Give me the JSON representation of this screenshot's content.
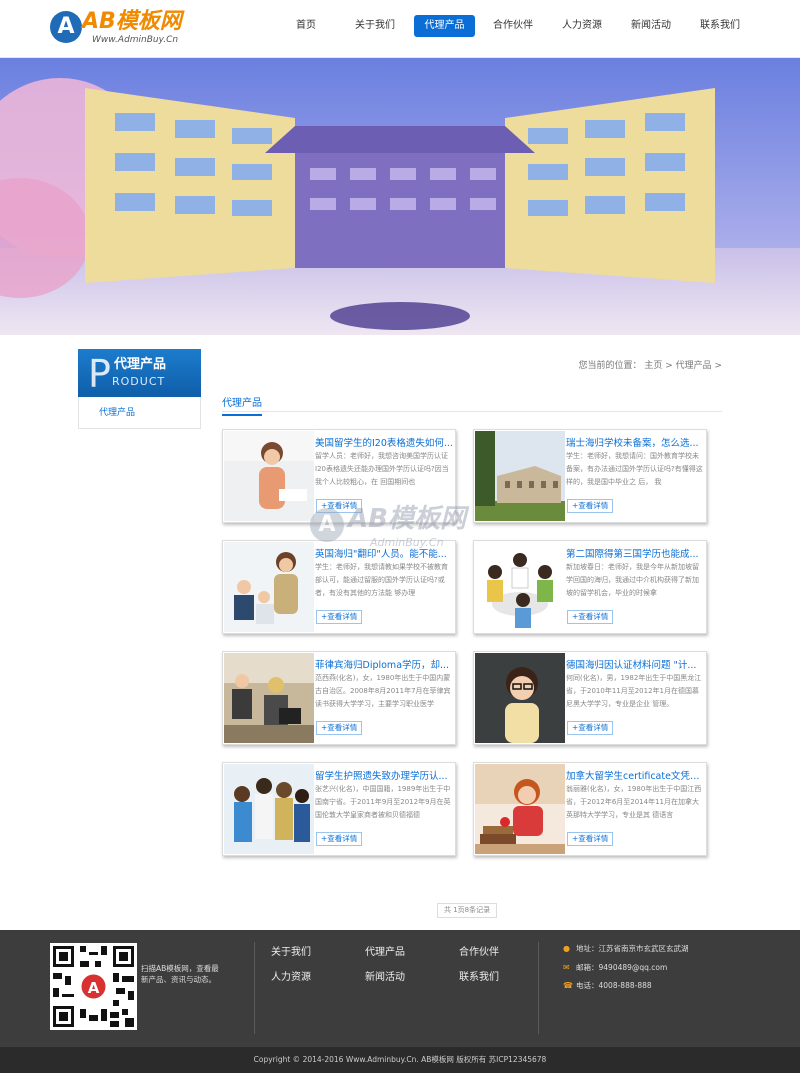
{
  "logo": {
    "letter": "A",
    "name": "AB模板网",
    "url": "Www.AdminBuy.Cn"
  },
  "nav": [
    {
      "label": "首页",
      "active": false
    },
    {
      "label": "关于我们",
      "active": false
    },
    {
      "label": "代理产品",
      "active": true
    },
    {
      "label": "合作伙伴",
      "active": false
    },
    {
      "label": "人力资源",
      "active": false
    },
    {
      "label": "新闻活动",
      "active": false
    },
    {
      "label": "联系我们",
      "active": false
    }
  ],
  "sidebar": {
    "title_letter": "P",
    "title_cn": "代理产品",
    "title_en": "RODUCT",
    "items": [
      {
        "label": "代理产品"
      }
    ]
  },
  "breadcrumb": "您当前的位置： 主页 > 代理产品 >",
  "section_title": "代理产品",
  "products": [
    {
      "title": "美国留学生的I20表格遗失如何...",
      "desc": "留学人员：老师好，我想咨询美国学历认证I20表格遗失还能办理国外学历认证吗?因当我个人比较粗心，在 回国期间也",
      "button": "+查看详情"
    },
    {
      "title": "瑞士海归学校未备案，怎么选...",
      "desc": "学生：老师好，我想请问：国外教育学校未备案，有办法通过国外学历认证吗?有懂得这样的，我是国中毕业之 后， 我",
      "button": "+查看详情"
    },
    {
      "title": "英国海归\"翻印\"人员。能不能...",
      "desc": "学生：老师好，我想请教如果学校不被教育部认可，能通过留服的国外学历认证吗?或者，有没有其他的方法能 够办理",
      "button": "+查看详情"
    },
    {
      "title": "第二国際得第三国学历也能成...",
      "desc": "新加坡春日：老师好，我是今年从新加坡留学回国的海归，我通过中介机构获得了新加坡的留学机会，毕业的时候拿",
      "button": "+查看详情"
    },
    {
      "title": "菲律宾海归Diploma学历，却...",
      "desc": "范西燕(化名)，女，1980年出生于中国内蒙古自治区。2008年8月2011年7月在菲律宾读书获得大学学习，主要学习职业医学",
      "button": "+查看详情"
    },
    {
      "title": "德国海归因认证材料问题 \"计...",
      "desc": "何同(化名)，男，1982年出生于中国黑龙江省，于2010年11月至2012年1月在德国慕尼黑大学学习，专业是企业 管理。",
      "button": "+查看详情"
    },
    {
      "title": "留学生护照遗失致办理学历认...",
      "desc": "张艺兴(化名)，中国国籍，1989年出生于中国南宁省。于2011年9月至2012年9月在英国伦敦大学皇家商者被和贝德福德",
      "button": "+查看详情"
    },
    {
      "title": "加拿大留学生certificate文凭办...",
      "desc": "翁丽雅(化名)，女，1980年出生于中国江西省，于2012年6月至2014年11月在加拿大英那特大学学习，专业是其 德语言",
      "button": "+查看详情"
    }
  ],
  "watermark": {
    "name": "AB模板网",
    "url": "AdminBuy.Cn"
  },
  "pager": "共 1页8条记录",
  "footer": {
    "qr_text": "扫描AB模板网，查看最新产品、资讯与动态。",
    "links": [
      "关于我们",
      "代理产品",
      "合作伙伴",
      "人力资源",
      "新闻活动",
      "联系我们"
    ],
    "address": "地址：江苏省南京市玄武区玄武湖",
    "email": "邮箱：9490489@qq.com",
    "phone": "电话：4008-888-888"
  },
  "copyright": "Copyright © 2014-2016 Www.Adminbuy.Cn. AB模板网 版权所有  苏ICP12345678",
  "colors": {
    "accent": "#0a6ed6",
    "footer_bg": "#3d3d3d",
    "logo_orange": "#f08a00"
  }
}
